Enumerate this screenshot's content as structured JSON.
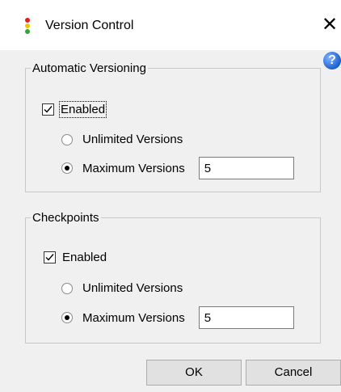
{
  "window": {
    "title": "Version Control"
  },
  "automatic": {
    "legend": "Automatic Versioning",
    "enabled_label": "Enabled",
    "enabled": true,
    "unlimited_label": "Unlimited Versions",
    "maximum_label": "Maximum Versions",
    "selected": "maximum",
    "maximum_value": "5"
  },
  "checkpoints": {
    "legend": "Checkpoints",
    "enabled_label": "Enabled",
    "enabled": true,
    "unlimited_label": "Unlimited Versions",
    "maximum_label": "Maximum Versions",
    "selected": "maximum",
    "maximum_value": "5"
  },
  "buttons": {
    "ok": "OK",
    "cancel": "Cancel"
  },
  "icons": {
    "close": "close-icon",
    "help": "help-icon",
    "app": "traffic-light-icon"
  },
  "colors": {
    "app_icon": [
      "#e0201c",
      "#f2c200",
      "#2fa63a"
    ],
    "titlebar_bg": "#ffffff",
    "dialog_bg": "#f0f0f0"
  }
}
